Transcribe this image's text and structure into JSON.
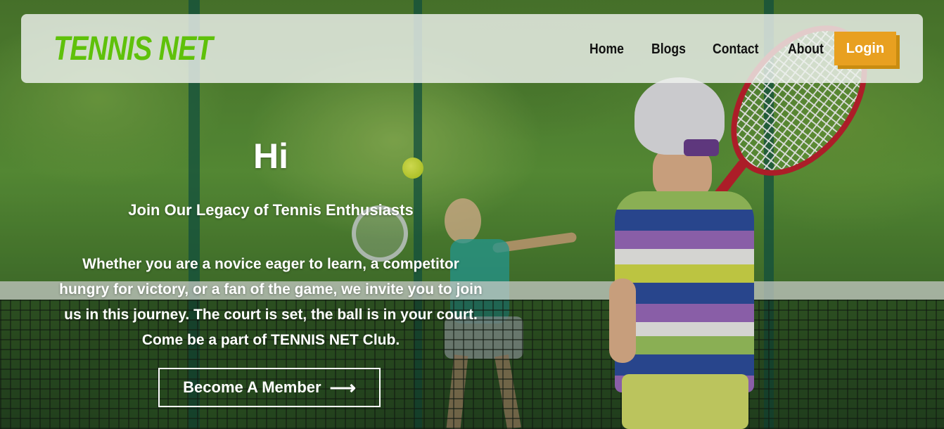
{
  "brand": {
    "logo_text": "TENNIS NET",
    "accent_color": "#5fc10a"
  },
  "nav": {
    "links": [
      "Home",
      "Blogs",
      "Contact",
      "About"
    ],
    "login_label": "Login",
    "login_color": "#e8a020"
  },
  "hero": {
    "greeting": "Hi",
    "tagline": "Join Our Legacy of Tennis Enthusiasts",
    "blurb": "Whether you are a novice eager to learn, a competitor hungry for victory, or a fan of the game, we invite you to join us in this journey. The court is set, the ball is in your court. Come be a part of TENNIS NET Club.",
    "cta_label": "Become A Member",
    "cta_icon": "arrow-right-icon"
  }
}
